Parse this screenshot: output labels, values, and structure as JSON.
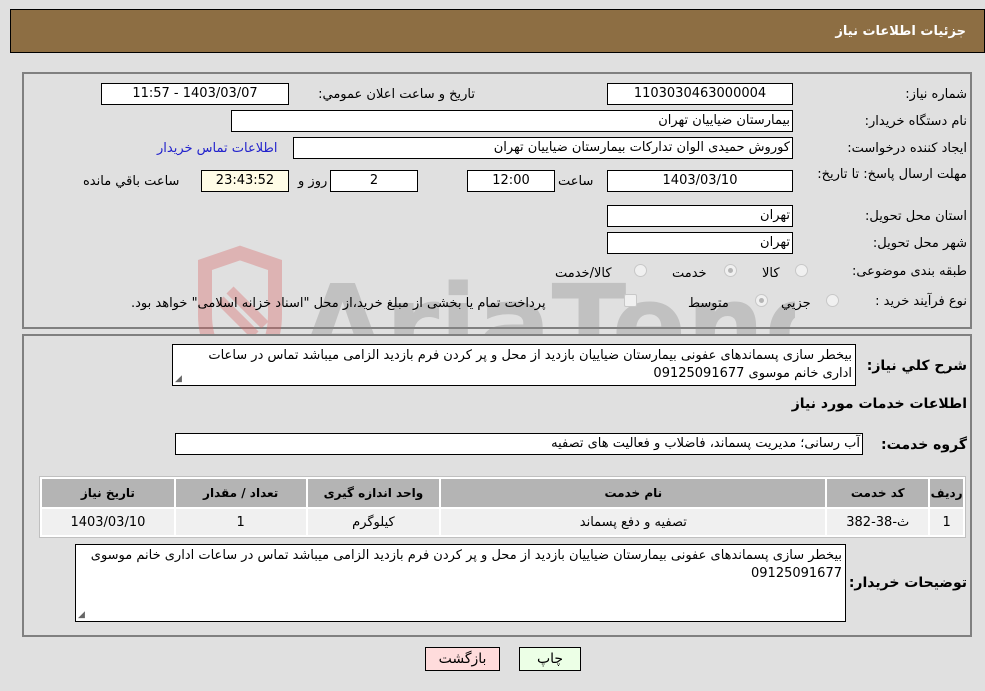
{
  "header": {
    "title": "جزئیات اطلاعات نیاز"
  },
  "details": {
    "need_number_label": "شماره نیاز:",
    "need_number": "1103030463000004",
    "announce_label": "تاریخ و ساعت اعلان عمومي:",
    "announce_value": "1403/03/07 - 11:57",
    "buyer_org_label": "نام دستگاه خریدار:",
    "buyer_org": "بیمارستان ضیاییان تهران",
    "creator_label": "ایجاد کننده درخواست:",
    "creator": "کوروش حمیدی الوان تدارکات بیمارستان ضیاییان تهران",
    "contact_link": "اطلاعات تماس خریدار",
    "deadline_label": "مهلت ارسال پاسخ: تا تاریخ:",
    "deadline_date": "1403/03/10",
    "time_label": "ساعت",
    "deadline_time": "12:00",
    "days_value": "2",
    "days_label": "روز و",
    "remaining_time": "23:43:52",
    "remaining_label": "ساعت باقي مانده",
    "province_label": "استان محل تحویل:",
    "province": "تهران",
    "city_label": "شهر محل تحویل:",
    "city": "تهران",
    "category_label": "طبقه بندی موضوعی:",
    "category_options": [
      {
        "label": "کالا",
        "selected": false
      },
      {
        "label": "خدمت",
        "selected": true
      },
      {
        "label": "کالا/خدمت",
        "selected": false
      }
    ],
    "process_label": "نوع فرآیند خرید :",
    "process_options": [
      {
        "label": "جزيي",
        "selected": false
      },
      {
        "label": "متوسط",
        "selected": true
      }
    ],
    "treasury_checkbox_label": "پرداخت تمام یا بخشی از مبلغ خرید،از محل \"اسناد خزانه اسلامی\" خواهد بود.",
    "treasury_checked": false
  },
  "description": {
    "label": "شرح کلي نیاز:",
    "text": "بیخطر سازی پسماندهای عفونی بیمارستان ضیاییان بازدید از محل و پر کردن فرم بازدید الزامی میباشد تماس در ساعات اداری خانم موسوی 09125091677"
  },
  "services": {
    "section_title": "اطلاعات خدمات مورد نیاز",
    "group_label": "گروه خدمت:",
    "group_value": "آب رسانی؛ مدیریت پسماند، فاضلاب و فعالیت های تصفیه",
    "table": {
      "headers": [
        "ردیف",
        "کد خدمت",
        "نام خدمت",
        "واحد اندازه گیری",
        "تعداد / مقدار",
        "تاریخ نیاز"
      ],
      "rows": [
        [
          "1",
          "ث-38-382",
          "تصفیه و دفع پسماند",
          "کیلوگرم",
          "1",
          "1403/03/10"
        ]
      ]
    }
  },
  "buyer_notes": {
    "label": "توضیحات خریدار:",
    "text": "بیخطر سازی پسماندهای عفونی بیمارستان ضیاییان بازدید از محل و پر کردن فرم بازدید الزامی میباشد تماس در ساعات اداری خانم موسوی 09125091677"
  },
  "buttons": {
    "print": "چاپ",
    "back": "بازگشت"
  },
  "watermark": {
    "text": "AriaTender.neT"
  },
  "colors": {
    "header_bg": "#8d6e43",
    "back_button_bg": "#ffdcdc",
    "print_button_bg": "#ecffe6",
    "link": "#2222cc"
  }
}
